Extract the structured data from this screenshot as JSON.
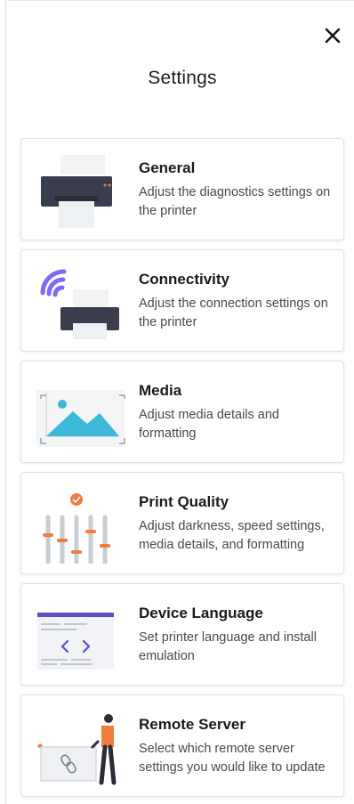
{
  "dialog": {
    "title": "Settings",
    "close_icon": "close-icon"
  },
  "items": [
    {
      "name": "General",
      "desc": "Adjust the diagnostics settings on the printer",
      "icon": "printer-illustration"
    },
    {
      "name": "Connectivity",
      "desc": "Adjust the connection settings on the printer",
      "icon": "wireless-printer-illustration"
    },
    {
      "name": "Media",
      "desc": "Adjust media details and formatting",
      "icon": "image-illustration"
    },
    {
      "name": "Print Quality",
      "desc": "Adjust darkness, speed settings, media details, and formatting",
      "icon": "sliders-illustration"
    },
    {
      "name": "Device Language",
      "desc": "Set printer language and install emulation",
      "icon": "code-window-illustration"
    },
    {
      "name": "Remote Server",
      "desc": "Select which remote server settings you would like to update",
      "icon": "person-link-illustration"
    }
  ],
  "colors": {
    "accent_purple": "#7b6cf6",
    "accent_orange": "#f07d3c",
    "accent_teal": "#3cb8d8",
    "printer_dark": "#3a3d4d"
  }
}
